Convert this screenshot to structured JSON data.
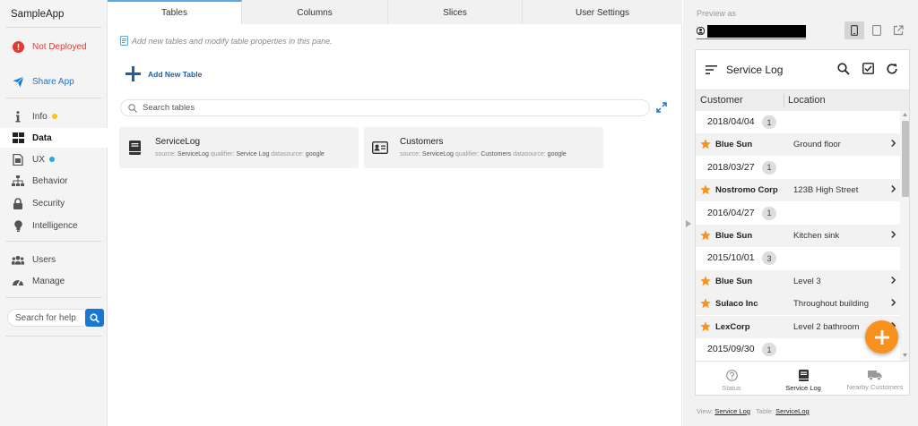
{
  "app": {
    "name": "SampleApp"
  },
  "nav": {
    "status": {
      "label": "Not Deployed",
      "color": "#e53935"
    },
    "share": {
      "label": "Share App",
      "color": "#1976d2"
    },
    "items": [
      {
        "label": "Info",
        "icon": "info-icon",
        "dot": "#f5c518"
      },
      {
        "label": "Data",
        "icon": "grid-icon",
        "active": true
      },
      {
        "label": "UX",
        "icon": "ux-icon",
        "dot": "#29a8e0"
      },
      {
        "label": "Behavior",
        "icon": "sitemap-icon"
      },
      {
        "label": "Security",
        "icon": "lock-icon"
      },
      {
        "label": "Intelligence",
        "icon": "lightbulb-icon"
      },
      {
        "label": "Users",
        "icon": "users-icon"
      },
      {
        "label": "Manage",
        "icon": "gauge-icon"
      }
    ],
    "help_placeholder": "Search for help"
  },
  "tabs": [
    {
      "label": "Tables",
      "active": true
    },
    {
      "label": "Columns"
    },
    {
      "label": "Slices"
    },
    {
      "label": "User Settings"
    }
  ],
  "main": {
    "hint": "Add new tables and modify table properties in this pane.",
    "add_table_label": "Add New Table",
    "search_placeholder": "Search tables",
    "tables": [
      {
        "name": "ServiceLog",
        "icon": "book-icon",
        "source_label": "source:",
        "source": "ServiceLog",
        "qualifier_label": "qualifier:",
        "qualifier": "Service Log",
        "datasource_label": "datasource:",
        "datasource": "google"
      },
      {
        "name": "Customers",
        "icon": "contact-card-icon",
        "source_label": "source:",
        "source": "ServiceLog",
        "qualifier_label": "qualifier:",
        "qualifier": "Customers",
        "datasource_label": "datasource:",
        "datasource": "google"
      }
    ]
  },
  "preview": {
    "label": "Preview as",
    "view_title": "Service Log",
    "columns": [
      "Customer",
      "Location"
    ],
    "rows": [
      {
        "type": "date",
        "text": "2018/04/04",
        "count": "1"
      },
      {
        "type": "item",
        "customer": "Blue Sun",
        "location": "Ground floor"
      },
      {
        "type": "date",
        "text": "2018/03/27",
        "count": "1"
      },
      {
        "type": "item",
        "customer": "Nostromo Corp",
        "location": "123B High Street"
      },
      {
        "type": "date",
        "text": "2016/04/27",
        "count": "1"
      },
      {
        "type": "item",
        "customer": "Blue Sun",
        "location": "Kitchen sink"
      },
      {
        "type": "date",
        "text": "2015/10/01",
        "count": "3"
      },
      {
        "type": "item",
        "customer": "Blue Sun",
        "location": "Level 3"
      },
      {
        "type": "item",
        "customer": "Sulaco Inc",
        "location": "Throughout building"
      },
      {
        "type": "item",
        "customer": "LexCorp",
        "location": "Level 2 bathroom"
      },
      {
        "type": "date",
        "text": "2015/09/30",
        "count": "1"
      }
    ],
    "bottom_nav": [
      {
        "label": "Status",
        "icon": "help-circle-icon"
      },
      {
        "label": "Service Log",
        "icon": "book-icon",
        "active": true
      },
      {
        "label": "Nearby Customers",
        "icon": "truck-icon"
      }
    ],
    "footer": {
      "view_label": "View:",
      "view": "Service Log",
      "table_label": "Table:",
      "table": "ServiceLog"
    },
    "accent": "#f7921e"
  }
}
